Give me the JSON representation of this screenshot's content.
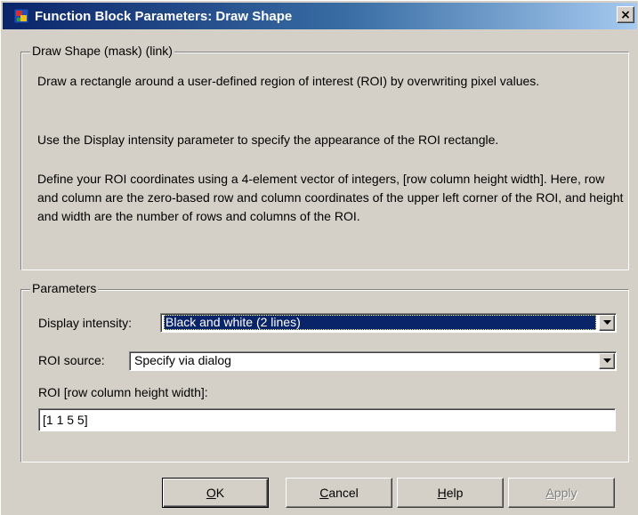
{
  "window": {
    "title": "Function Block Parameters: Draw Shape",
    "close_glyph": "×"
  },
  "description_group": {
    "legend": "Draw Shape (mask) (link)",
    "paragraphs": [
      "Draw a rectangle around a user-defined region of interest (ROI) by overwriting pixel values.",
      "Use the Display intensity parameter to specify the appearance of the ROI rectangle.",
      "Define your ROI coordinates using a 4-element vector of integers, [row column height width]. Here, row and column are the zero-based row and column coordinates of the upper left corner of the ROI, and height and width are the number of rows and columns of the ROI."
    ]
  },
  "parameters_group": {
    "legend": "Parameters",
    "display_intensity": {
      "label": "Display intensity:",
      "value": "Black and white (2 lines)"
    },
    "roi_source": {
      "label": "ROI source:",
      "value": "Specify via dialog"
    },
    "roi": {
      "label": "ROI [row column height width]:",
      "value": "[1 1 5 5]"
    }
  },
  "buttons": {
    "ok": {
      "mnemonic": "O",
      "rest": "K"
    },
    "cancel": {
      "mnemonic": "C",
      "rest": "ancel"
    },
    "help": {
      "mnemonic": "H",
      "rest": "elp"
    },
    "apply": {
      "mnemonic": "A",
      "rest": "pply"
    }
  },
  "icons": {
    "app": "simulink-block-icon",
    "combo_arrow": "chevron-down-icon"
  },
  "colors": {
    "titlebar_start": "#0a246a",
    "titlebar_end": "#a6caf0",
    "selection": "#0a246a",
    "dialog_bg": "#d4d0c8"
  }
}
